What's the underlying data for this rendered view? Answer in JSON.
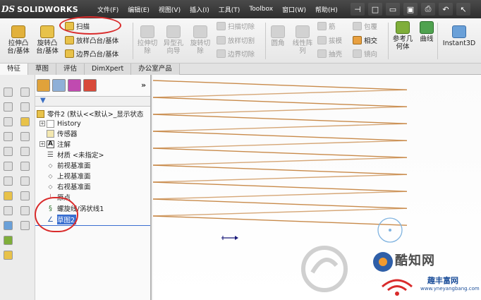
{
  "app": {
    "ds_mark": "DS",
    "brand": "SOLIDWORKS"
  },
  "menu": [
    "文件(F)",
    "编辑(E)",
    "视图(V)",
    "插入(I)",
    "工具(T)",
    "Toolbox",
    "窗口(W)",
    "帮助(H)"
  ],
  "quick_access": [
    {
      "icon": "pin-icon",
      "glyph": "⊣"
    },
    {
      "icon": "new-document-icon",
      "glyph": "□"
    },
    {
      "icon": "open-folder-icon",
      "glyph": "▭"
    },
    {
      "icon": "save-icon",
      "glyph": "▣"
    },
    {
      "icon": "print-icon",
      "glyph": "⎙"
    },
    {
      "icon": "undo-icon",
      "glyph": "↶"
    },
    {
      "icon": "select-icon",
      "glyph": "↖"
    }
  ],
  "ribbon": {
    "extrude_boss": "拉伸凸\n台/基体",
    "revolve_boss": "旋转凸\n台/基体",
    "sweep": "扫描",
    "loft_boss": "放样凸台/基体",
    "boundary_boss": "边界凸台/基体",
    "extrude_cut": "拉伸切\n除",
    "hole_wizard": "异型孔\n向导",
    "revolve_cut": "旋转切\n除",
    "swept_cut": "扫描切除",
    "lofted_cut": "放样切割",
    "boundary_cut": "边界切除",
    "fillet": "圆角",
    "linear_pattern": "线性阵\n列",
    "rib": "筋",
    "draft": "拔模",
    "shell": "抽壳",
    "wrap": "包覆",
    "intersect": "相交",
    "mirror": "镜向",
    "reference_geometry": "参考几\n何体",
    "curves": "曲线",
    "instant3d": "Instant3D"
  },
  "tabs": [
    {
      "label": "特征",
      "active": true
    },
    {
      "label": "草图",
      "active": false
    },
    {
      "label": "评估",
      "active": false
    },
    {
      "label": "DimXpert",
      "active": false
    },
    {
      "label": "办公室产品",
      "active": false
    }
  ],
  "panel": {
    "expand_glyph": "»",
    "filter_glyph": "▼"
  },
  "tree": {
    "part": "零件2 (默认<<默认>_显示状态",
    "history": "History",
    "sensors": "传感器",
    "annotations": "注解",
    "material": "材质 <未指定>",
    "front_plane": "前视基准面",
    "top_plane": "上视基准面",
    "right_plane": "右视基准面",
    "origin": "原点",
    "helix": "螺旋线/涡状线1",
    "sketch2": "草图2"
  },
  "colors": {
    "helix": "#c88a4a",
    "highlight_oval": "#d92b2b",
    "selection": "#3a6fd0",
    "cursor_circle": "#7fb3e0"
  },
  "watermark": {
    "text": "酷知网",
    "badge": "趣丰富网",
    "url": "www.yneyangbang.com"
  }
}
